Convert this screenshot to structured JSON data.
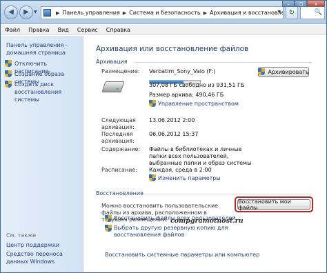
{
  "window": {
    "title_buttons": {
      "minimize": "–",
      "maximize": "□",
      "close": "x"
    }
  },
  "navigation": {
    "back": "◀",
    "forward": "▶",
    "breadcrumb": [
      "Панель управления",
      "Система и безопасность",
      "Архивация и восстановление"
    ],
    "refresh": "↻",
    "search_hint": "🔍"
  },
  "menu": [
    "Файл",
    "Правка",
    "Вид",
    "Сервис",
    "Справка"
  ],
  "sidebar": {
    "home": "Панель управления - домашняя страница",
    "tasks": [
      "Отключить расписание",
      "Создание образа системы",
      "Создать диск восстановления системы"
    ],
    "see_also_title": "См. также",
    "see_also": [
      "Центр поддержки",
      "Средство переноса данных Windows"
    ]
  },
  "main": {
    "title": "Архивация или восстановление файлов",
    "backup": {
      "section_title": "Архивация",
      "location_label": "Размещение:",
      "location_value": "Verbatim_Sony_Vaio (F:)",
      "free_space": "307,08 ГБ свободно из 931,51 ГБ",
      "used_fraction": 0.67,
      "archive_size": "Размер архива: 490,46 ГБ",
      "manage_space_link": "Управление пространством",
      "archive_button": "Архивировать",
      "next_label": "Следующая архивация:",
      "next_value": "13.06.2012 2:00",
      "last_label": "Последняя архивация:",
      "last_value": "06.06.2012 15:37",
      "content_label": "Содержание:",
      "content_value": "Файлы в библиотеках и личные папки всех пользователей, выбранные папки и образ системы",
      "schedule_label": "Расписание:",
      "schedule_value": "Каждая, среда в 2:00",
      "change_settings_link": "Изменить параметры"
    },
    "restore": {
      "section_title": "Восстановление",
      "description": "Можно восстановить пользовательские файлы из архива, расположенном в текущем размещении.",
      "restore_button": "Восстановить мои файлы",
      "restore_all_link": "Восстановить файлы всех пользователей",
      "choose_other_link": "Выбрать другую резервную копию для восстановления файлов",
      "restore_system_link": "Восстановить системные параметры или компьютер"
    }
  },
  "watermark": "compgramotnost.ru"
}
